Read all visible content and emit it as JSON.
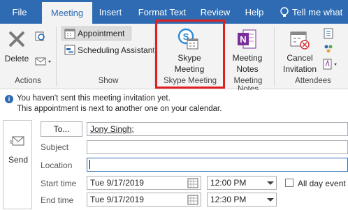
{
  "tabs": [
    {
      "label": "File"
    },
    {
      "label": "Meeting"
    },
    {
      "label": "Insert"
    },
    {
      "label": "Format Text"
    },
    {
      "label": "Review"
    },
    {
      "label": "Help"
    },
    {
      "label": "Tell me what y"
    }
  ],
  "ribbon": {
    "actions": {
      "delete_label": "Delete",
      "group_label": "Actions"
    },
    "show": {
      "appointment_label": "Appointment",
      "scheduling_label": "Scheduling Assistant",
      "group_label": "Show"
    },
    "skype": {
      "button_line1": "Skype",
      "button_line2": "Meeting",
      "group_label": "Skype Meeting"
    },
    "notes": {
      "button_line1": "Meeting",
      "button_line2": "Notes",
      "group_label": "Meeting Notes"
    },
    "attendees": {
      "cancel_line1": "Cancel",
      "cancel_line2": "Invitation",
      "group_label": "Attendees"
    }
  },
  "infobar": {
    "line1": "You haven't sent this meeting invitation yet.",
    "line2": "This appointment is next to another one on your calendar."
  },
  "form": {
    "send_label": "Send",
    "to_label": "To...",
    "to_value": "Jony Singh;",
    "subject_label": "Subject",
    "subject_value": "",
    "location_label": "Location",
    "location_value": "",
    "start_label": "Start time",
    "start_date": "Tue 9/17/2019",
    "start_time": "12:00 PM",
    "end_label": "End time",
    "end_date": "Tue 9/17/2019",
    "end_time": "12:30 PM",
    "allday_label": "All day event"
  },
  "colors": {
    "accent": "#2e6bb3",
    "highlight": "#e0201f",
    "onenote": "#7b2f9a"
  }
}
